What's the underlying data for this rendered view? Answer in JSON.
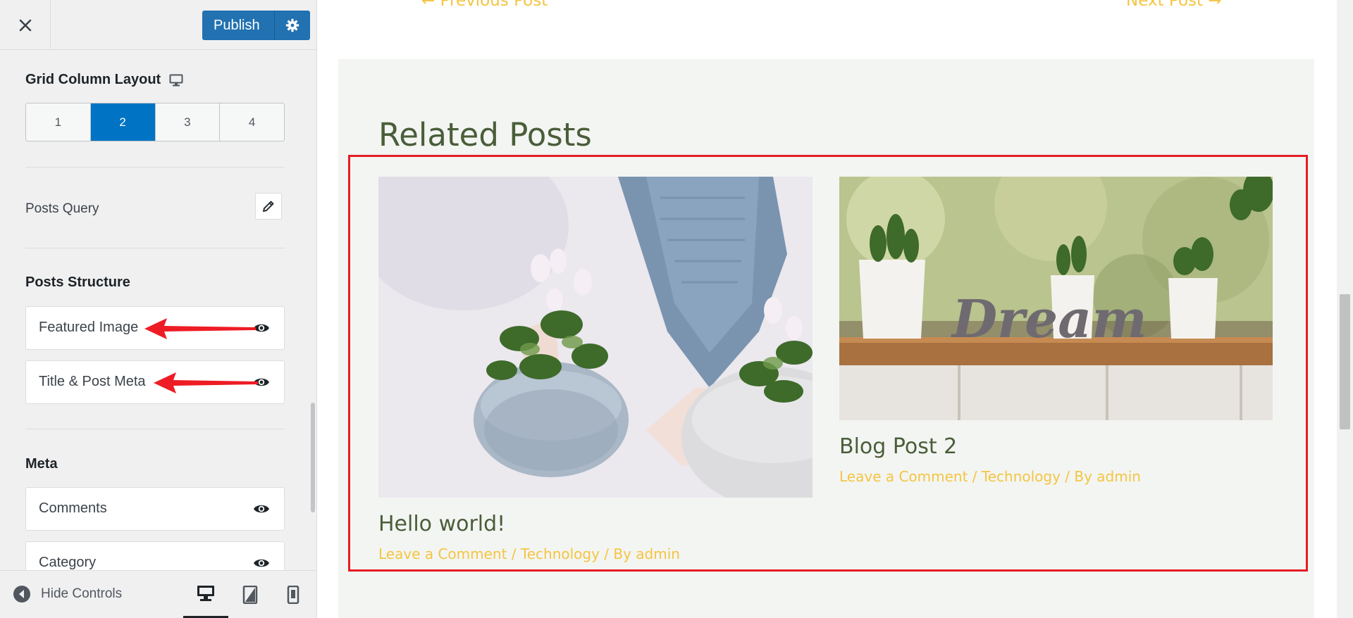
{
  "topbar": {
    "publish_label": "Publish"
  },
  "grid": {
    "title": "Grid Column Layout",
    "columns": [
      "1",
      "2",
      "3",
      "4"
    ],
    "selected": "2"
  },
  "posts_query": {
    "label": "Posts Query"
  },
  "posts_structure": {
    "title": "Posts Structure",
    "items": [
      {
        "label": "Featured Image"
      },
      {
        "label": "Title & Post Meta"
      }
    ]
  },
  "meta": {
    "title": "Meta",
    "items": [
      {
        "label": "Comments"
      },
      {
        "label": "Category"
      }
    ]
  },
  "footer": {
    "hide_controls": "Hide Controls"
  },
  "preview": {
    "prev_post": "← Previous Post",
    "next_post": "Next Post →",
    "related_title": "Related Posts",
    "posts": [
      {
        "title": "Hello world!",
        "meta": "Leave a Comment / Technology / By admin"
      },
      {
        "title": "Blog Post 2",
        "meta": "Leave a Comment / Technology / By admin"
      }
    ]
  },
  "colors": {
    "accent": "#2271b1",
    "active_column": "#0073c4",
    "highlight": "#e51d25",
    "arrow": "#ee1c24",
    "heading_green": "#4a5d3a",
    "meta_yellow": "#f4c542"
  },
  "icons": [
    "close-icon",
    "gear-icon",
    "monitor-icon",
    "pencil-icon",
    "eye-icon",
    "arrow-left-circle-icon",
    "desktop-icon",
    "tablet-icon",
    "mobile-icon"
  ]
}
